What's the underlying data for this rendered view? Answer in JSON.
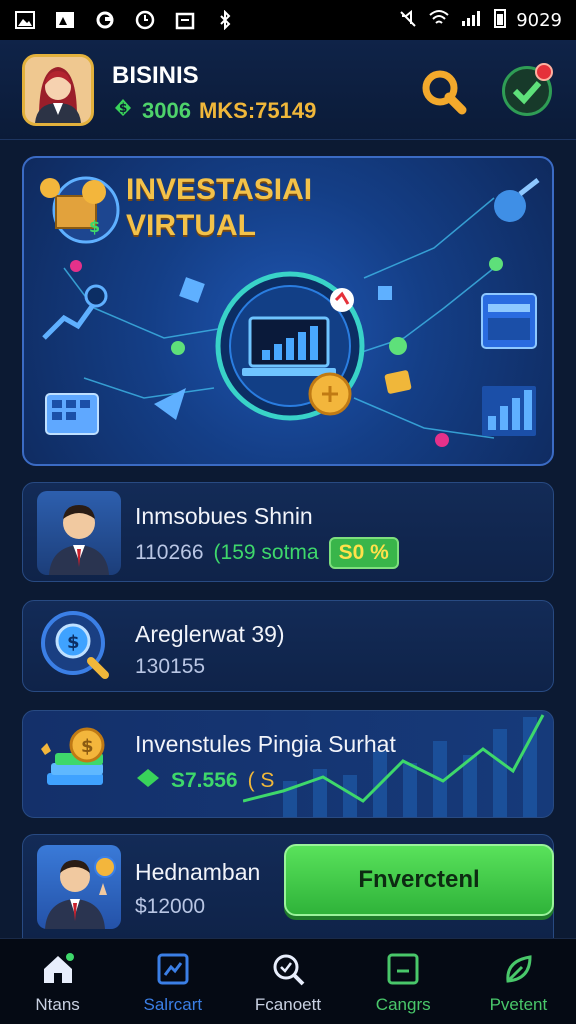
{
  "status_bar": {
    "time": "9029"
  },
  "header": {
    "name": "BISINIS",
    "balance_amount": "3006",
    "balance_stock": "MKS:75149"
  },
  "banner": {
    "title_line1": "INVESTASIAI",
    "title_line2": "VIRTUAL"
  },
  "cards": [
    {
      "title": "Inmsobues Shnin",
      "value": "110266",
      "paren_text": "(159 sotma",
      "badge": "S0 %"
    },
    {
      "title": "Areglerwat 39)",
      "value": "130155"
    },
    {
      "title": "Invenstules Pingia Surhat",
      "amount": "S7.556",
      "paren_text": "( S"
    },
    {
      "title": "Hednamban",
      "amount": "$12000"
    }
  ],
  "invest_button": {
    "label": "Fnverctenl"
  },
  "bottom_nav": [
    {
      "label": "Ntans",
      "icon": "home-icon"
    },
    {
      "label": "Salrcart",
      "icon": "chart-icon"
    },
    {
      "label": "Fcanoett",
      "icon": "search-icon"
    },
    {
      "label": "Cangrs",
      "icon": "card-icon"
    },
    {
      "label": "Pvetent",
      "icon": "leaf-icon"
    }
  ],
  "colors": {
    "background": "#0c1a33",
    "accent_gold": "#f0b73a",
    "accent_green": "#3ed86b",
    "accent_blue": "#3b7fe6"
  }
}
